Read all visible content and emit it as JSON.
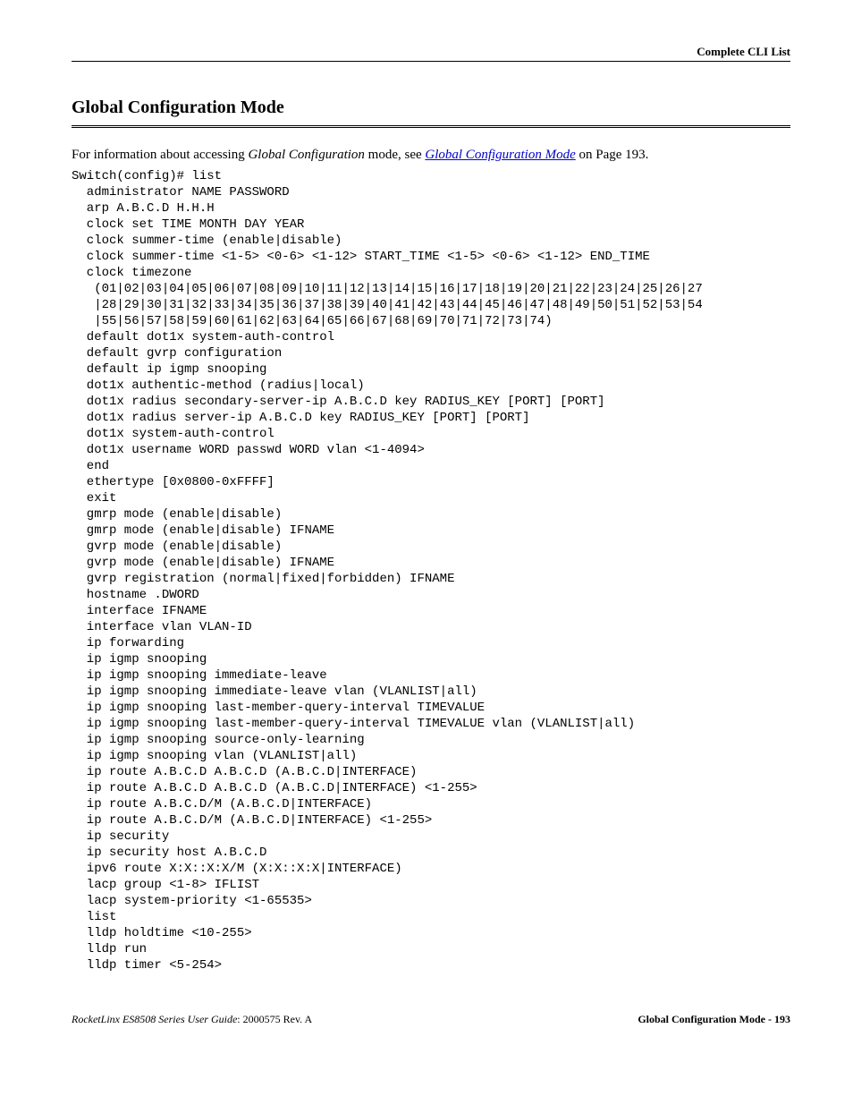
{
  "header": {
    "running_title": "Complete CLI List"
  },
  "title": "Global Configuration Mode",
  "intro": {
    "prefix": "For information about accessing ",
    "mode_name": "Global Configuration",
    "mid": " mode, see ",
    "link_text": "Global Configuration Mode",
    "suffix": " on Page 193."
  },
  "cli": "Switch(config)# list\n  administrator NAME PASSWORD\n  arp A.B.C.D H.H.H\n  clock set TIME MONTH DAY YEAR\n  clock summer-time (enable|disable)\n  clock summer-time <1-5> <0-6> <1-12> START_TIME <1-5> <0-6> <1-12> END_TIME\n  clock timezone \n   (01|02|03|04|05|06|07|08|09|10|11|12|13|14|15|16|17|18|19|20|21|22|23|24|25|26|27\n   |28|29|30|31|32|33|34|35|36|37|38|39|40|41|42|43|44|45|46|47|48|49|50|51|52|53|54\n   |55|56|57|58|59|60|61|62|63|64|65|66|67|68|69|70|71|72|73|74)\n  default dot1x system-auth-control\n  default gvrp configuration\n  default ip igmp snooping\n  dot1x authentic-method (radius|local)\n  dot1x radius secondary-server-ip A.B.C.D key RADIUS_KEY [PORT] [PORT]\n  dot1x radius server-ip A.B.C.D key RADIUS_KEY [PORT] [PORT]\n  dot1x system-auth-control\n  dot1x username WORD passwd WORD vlan <1-4094>\n  end\n  ethertype [0x0800-0xFFFF]\n  exit\n  gmrp mode (enable|disable)\n  gmrp mode (enable|disable) IFNAME\n  gvrp mode (enable|disable)\n  gvrp mode (enable|disable) IFNAME\n  gvrp registration (normal|fixed|forbidden) IFNAME\n  hostname .DWORD\n  interface IFNAME\n  interface vlan VLAN-ID\n  ip forwarding\n  ip igmp snooping\n  ip igmp snooping immediate-leave\n  ip igmp snooping immediate-leave vlan (VLANLIST|all)\n  ip igmp snooping last-member-query-interval TIMEVALUE\n  ip igmp snooping last-member-query-interval TIMEVALUE vlan (VLANLIST|all)\n  ip igmp snooping source-only-learning\n  ip igmp snooping vlan (VLANLIST|all)\n  ip route A.B.C.D A.B.C.D (A.B.C.D|INTERFACE)\n  ip route A.B.C.D A.B.C.D (A.B.C.D|INTERFACE) <1-255>\n  ip route A.B.C.D/M (A.B.C.D|INTERFACE)\n  ip route A.B.C.D/M (A.B.C.D|INTERFACE) <1-255>\n  ip security\n  ip security host A.B.C.D\n  ipv6 route X:X::X:X/M (X:X::X:X|INTERFACE)\n  lacp group <1-8> IFLIST\n  lacp system-priority <1-65535>\n  list\n  lldp holdtime <10-255>\n  lldp run\n  lldp timer <5-254>",
  "footer": {
    "left_italic": "RocketLinx ES8508 Series  User Guide",
    "left_plain": ": 2000575 Rev. A",
    "right": "Global Configuration Mode - 193"
  }
}
